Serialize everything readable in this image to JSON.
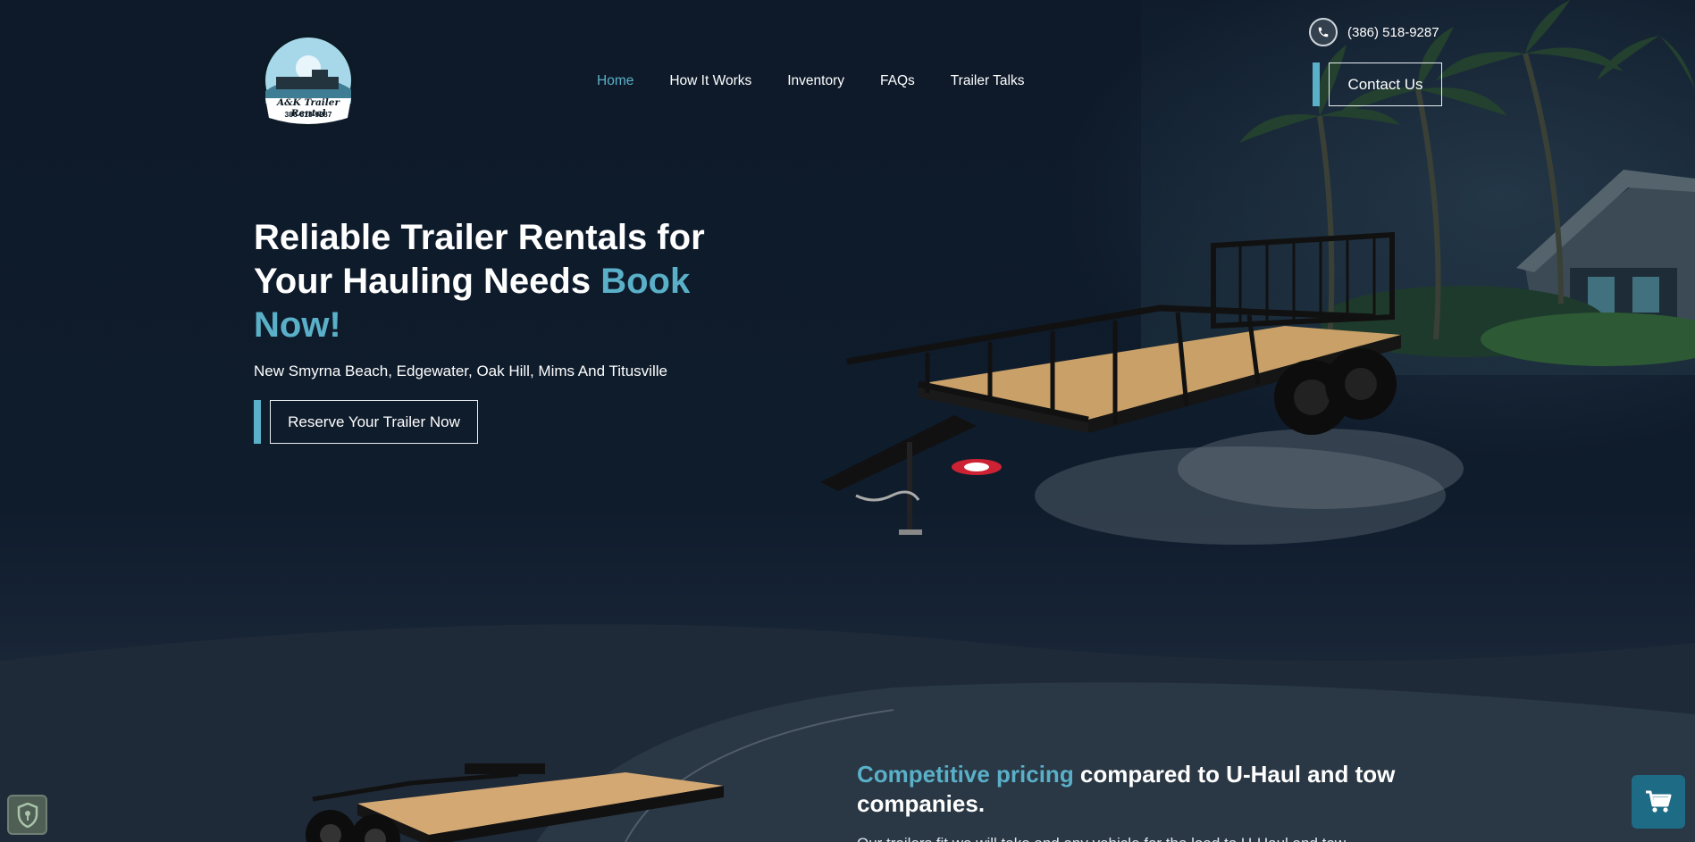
{
  "header": {
    "logo": {
      "name": "A&K Trailer Rental",
      "phone": "386-518-9287"
    },
    "nav": [
      {
        "label": "Home",
        "active": true
      },
      {
        "label": "How It Works",
        "active": false
      },
      {
        "label": "Inventory",
        "active": false
      },
      {
        "label": "FAQs",
        "active": false
      },
      {
        "label": "Trailer Talks",
        "active": false
      }
    ],
    "phone": "(386) 518-9287",
    "contact_label": "Contact Us"
  },
  "hero": {
    "title_main": "Reliable Trailer Rentals for Your Hauling Needs ",
    "title_accent": "Book Now!",
    "subtitle": "New Smyrna Beach, Edgewater, Oak Hill, Mims And Titusville",
    "cta_label": "Reserve Your Trailer Now"
  },
  "promo": {
    "heading_accent": "Competitive pricing",
    "heading_rest": " compared to U-Haul and tow companies.",
    "body": "Our trailers fit we will take and any vehicle for the load to U-Haul and tow"
  },
  "colors": {
    "accent": "#5ab0c8",
    "background": "#0f1b2b",
    "cart_button": "#1d6b85"
  },
  "icons": {
    "phone": "phone-icon",
    "shield": "shield-icon",
    "cart": "cart-icon"
  }
}
